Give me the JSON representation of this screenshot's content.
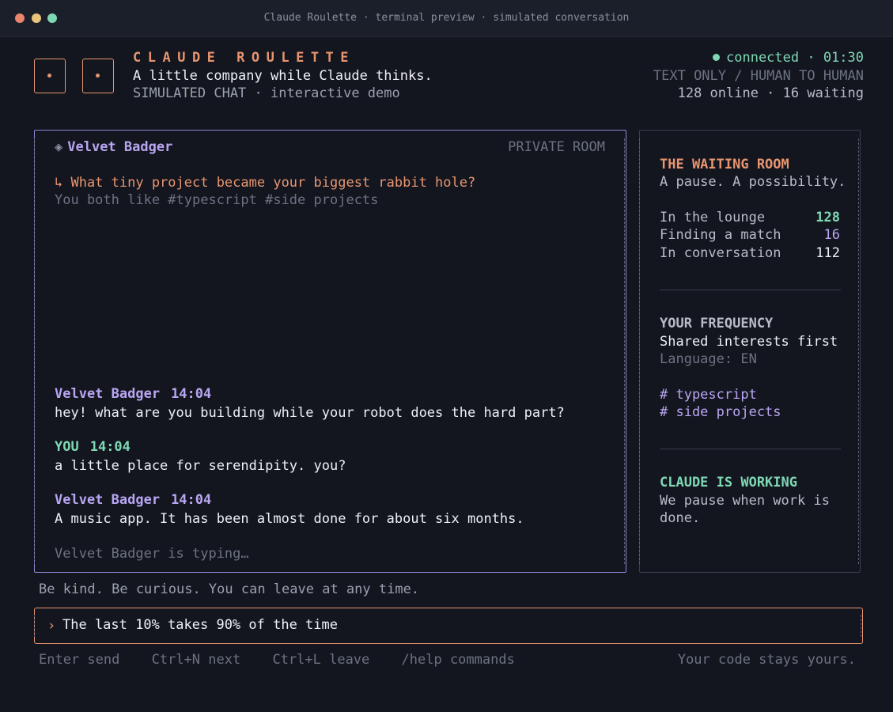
{
  "window": {
    "title": "Claude Roulette · terminal preview · simulated conversation"
  },
  "header": {
    "brand": "CLAUDE ROULETTE",
    "tagline": "A little company while Claude thinks.",
    "subtitle": "SIMULATED CHAT · interactive demo",
    "status": "connected · 01:30",
    "mode": "TEXT ONLY / HUMAN TO HUMAN",
    "online": "128 online · 16 waiting"
  },
  "chat": {
    "peer_name": "Velvet Badger",
    "room_label": "PRIVATE ROOM",
    "prompt_question": "↳ What tiny project became your biggest rabbit hole?",
    "shared_interests": "You both like #typescript  #side projects",
    "messages": [
      {
        "author": "Velvet Badger",
        "time": "14:04",
        "text": "hey! what are you building while your robot does the hard part?"
      },
      {
        "author": "YOU",
        "time": "14:04",
        "text": "a little place for serendipity. you?"
      },
      {
        "author": "Velvet Badger",
        "time": "14:04",
        "text": "A music app. It has been almost done for about six months."
      }
    ],
    "typing": "Velvet Badger is typing…"
  },
  "side": {
    "waiting_title": "THE WAITING ROOM",
    "waiting_sub": "A pause. A possibility.",
    "stats": [
      {
        "label": "In the lounge",
        "value": "128"
      },
      {
        "label": "Finding a match",
        "value": "16"
      },
      {
        "label": "In conversation",
        "value": "112"
      }
    ],
    "freq_title": "YOUR FREQUENCY",
    "freq_mode": "Shared interests first",
    "freq_lang": "Language: EN",
    "tags": [
      "# typescript",
      "# side projects"
    ],
    "working_title": "CLAUDE IS WORKING",
    "working_line1": "We pause when work is",
    "working_line2": "done."
  },
  "footnote": "Be kind. Be curious. You can leave at any time.",
  "input": {
    "caret": "›",
    "value": "The last 10% takes 90% of the time"
  },
  "hints": {
    "send": "Enter send",
    "next": "Ctrl+N next",
    "leave": "Ctrl+L leave",
    "help": "/help commands",
    "privacy": "Your code stays yours."
  },
  "colors": {
    "accent": "#e8956f",
    "peer": "#b9a6f2",
    "self": "#7fd8b4",
    "background": "#13161f"
  }
}
